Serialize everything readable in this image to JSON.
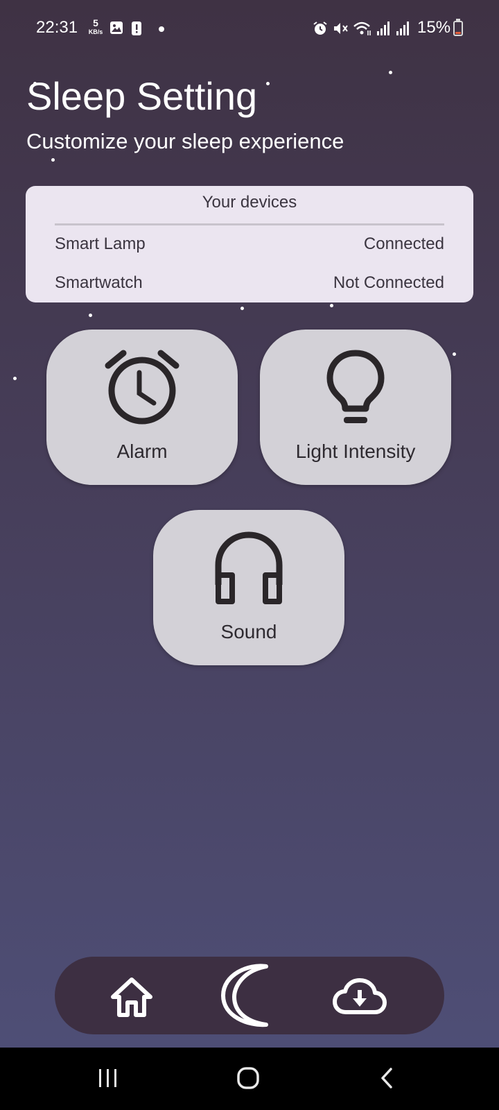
{
  "status_bar": {
    "time": "22:31",
    "net_speed_value": "5",
    "net_speed_unit": "KB/s",
    "battery": "15%",
    "battery_level": 0.15,
    "icons": [
      "image-icon",
      "alert-icon",
      "dot-icon",
      "alarm-icon",
      "mute-icon",
      "wifi-icon",
      "signal-icon",
      "signal-icon",
      "battery-icon"
    ]
  },
  "header": {
    "title": "Sleep Setting",
    "subtitle": "Customize your sleep experience"
  },
  "devices": {
    "title": "Your devices",
    "items": [
      {
        "name": "Smart Lamp",
        "status": "Connected"
      },
      {
        "name": "Smartwatch",
        "status": "Not Connected"
      }
    ]
  },
  "tiles": [
    {
      "label": "Alarm",
      "icon": "alarm-clock-icon"
    },
    {
      "label": "Light Intensity",
      "icon": "lightbulb-icon"
    },
    {
      "label": "Sound",
      "icon": "headphones-icon"
    }
  ],
  "bottom_nav": {
    "items": [
      {
        "icon": "home-icon"
      },
      {
        "icon": "moon-icon",
        "active": true
      },
      {
        "icon": "cloud-download-icon"
      }
    ]
  },
  "system_nav": [
    "recents-icon",
    "home-circle-icon",
    "back-icon"
  ],
  "colors": {
    "background_top": "#3f3244",
    "background_bottom": "#4f5079",
    "card": "#ebe5f0",
    "tile": "#d3d1d7",
    "nav_bar": "#3d2f42",
    "battery_low": "#e25d3b"
  }
}
